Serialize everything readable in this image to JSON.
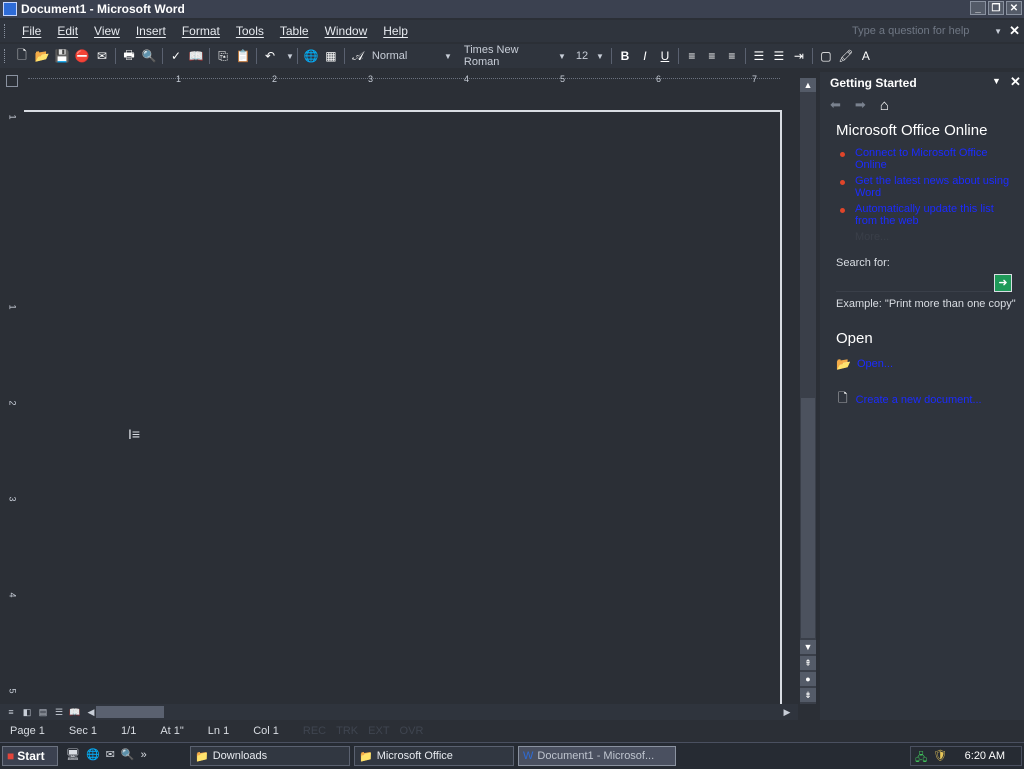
{
  "window": {
    "title": "Document1 - Microsoft Word"
  },
  "menubar": {
    "items": [
      "File",
      "Edit",
      "View",
      "Insert",
      "Format",
      "Tools",
      "Table",
      "Window",
      "Help"
    ],
    "help_placeholder": "Type a question for help"
  },
  "toolbar": {
    "style": "Normal",
    "font": "Times New Roman",
    "size": "12"
  },
  "ruler": {
    "numbers": [
      "1",
      "2",
      "3",
      "4",
      "5",
      "6",
      "7"
    ]
  },
  "vruler": {
    "numbers": [
      "1",
      "1",
      "2",
      "3",
      "4",
      "5"
    ]
  },
  "taskpane": {
    "title": "Getting Started",
    "online_title": "Microsoft Office Online",
    "links": [
      "Connect to Microsoft Office Online",
      "Get the latest news about using Word",
      "Automatically update this list from the web"
    ],
    "more": "More...",
    "search_label": "Search for:",
    "example": "Example:  \"Print more than one copy\"",
    "open_title": "Open",
    "open_link": "Open...",
    "create_link": "Create a new document..."
  },
  "statusbar": {
    "page": "Page 1",
    "sec": "Sec 1",
    "pages": "1/1",
    "at": "At 1\"",
    "ln": "Ln 1",
    "col": "Col 1",
    "rec": "REC",
    "trk": "TRK",
    "ext": "EXT",
    "ovr": "OVR"
  },
  "taskbar": {
    "start": "Start",
    "tasks": [
      "Downloads",
      "Microsoft Office",
      "Document1 - Microsof..."
    ],
    "clock": "6:20 AM"
  }
}
